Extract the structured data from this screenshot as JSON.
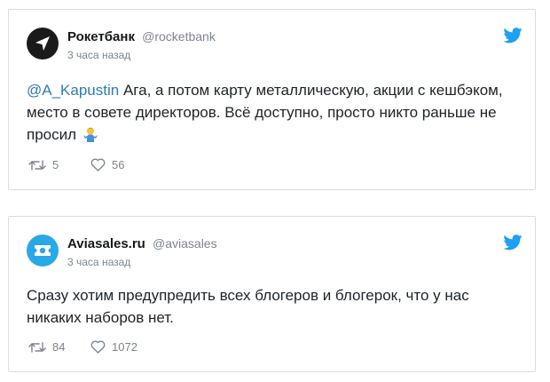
{
  "tweets": [
    {
      "name": "Рокетбанк",
      "handle": "@rocketbank",
      "time": "3 часа назад",
      "mention": "@A_Kapustin",
      "text": " Ага, а потом карту металлическую, акции с кешбэком, место в совете директоров. Всё доступно, просто никто раньше не просил",
      "emoji": "man-shrugging-emoji",
      "retweets": "5",
      "likes": "56"
    },
    {
      "name": "Aviasales.ru",
      "handle": "@aviasales",
      "time": "3 часа назад",
      "text": "Сразу хотим предупредить всех блогеров и блогерок, что у нас никаких наборов нет.",
      "retweets": "84",
      "likes": "1072"
    }
  ],
  "icons": {
    "twitter": "twitter-bird-icon",
    "retweet": "retweet-icon",
    "like": "heart-icon"
  },
  "colors": {
    "twitter_blue": "#1da1f2",
    "link_blue": "#2b7bb9",
    "rocketbank_avatar": "#1a1a1a",
    "aviasales_avatar": "#29a8e8",
    "meta_gray": "#7a8591"
  }
}
